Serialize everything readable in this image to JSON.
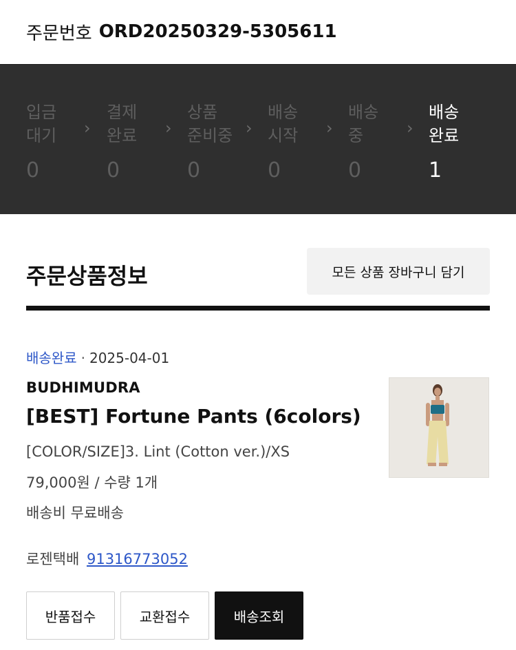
{
  "order": {
    "label": "주문번호",
    "number": "ORD20250329-5305611"
  },
  "steps": [
    {
      "name": "입금\n대기",
      "count": "0"
    },
    {
      "name": "결제\n완료",
      "count": "0"
    },
    {
      "name": "상품\n준비중",
      "count": "0"
    },
    {
      "name": "배송\n시작",
      "count": "0"
    },
    {
      "name": "배송\n중",
      "count": "0"
    },
    {
      "name": "배송\n완료",
      "count": "1"
    }
  ],
  "section": {
    "title": "주문상품정보",
    "cart_button": "모든 상품 장바구니 담기"
  },
  "item": {
    "status": "배송완료",
    "dot": "·",
    "date": "2025-04-01",
    "brand": "BUDHIMUDRA",
    "name": "[BEST] Fortune Pants (6colors)",
    "option": "[COLOR/SIZE]3. Lint (Cotton ver.)/XS",
    "price": "79,000원 / 수량 1개",
    "shipping": "배송비 무료배송",
    "courier": "로젠택배",
    "tracking": "91316773052"
  },
  "actions": {
    "return": "반품접수",
    "exchange": "교환접수",
    "track": "배송조회"
  },
  "colors": {
    "accent_blue": "#2d57c8",
    "status_bar": "#2f2f2f"
  }
}
